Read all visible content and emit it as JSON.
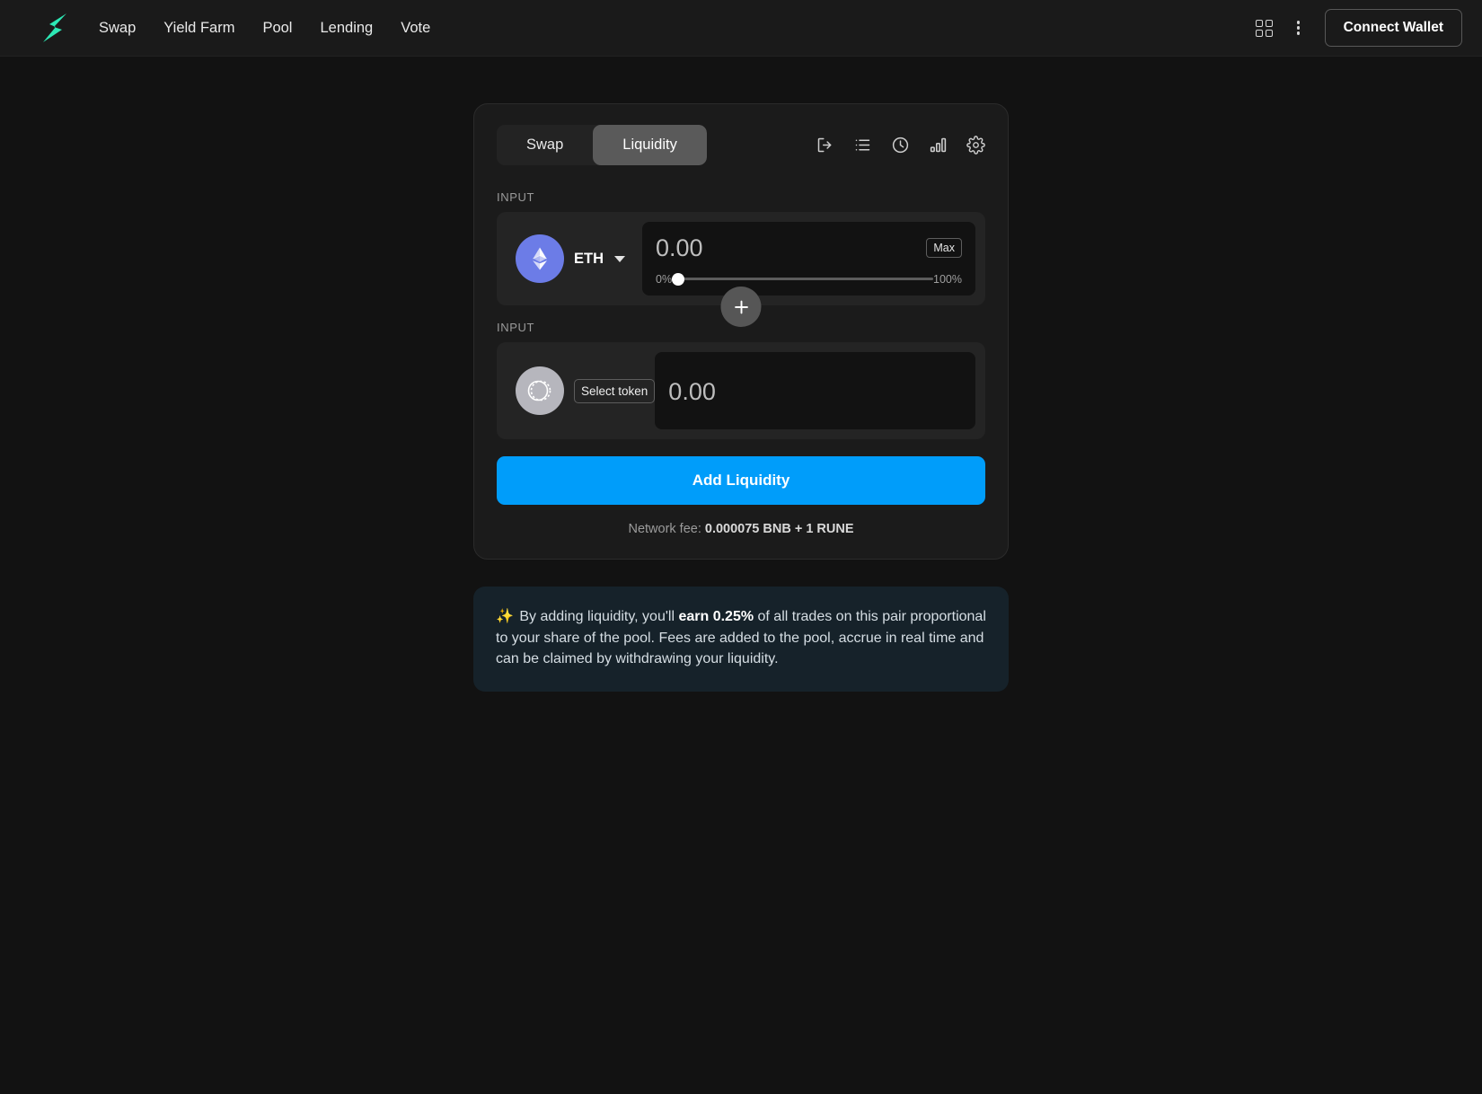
{
  "header": {
    "logo_icon": "lightning-bolt-logo",
    "logo_color": "#2de8b5",
    "nav": [
      {
        "label": "Swap"
      },
      {
        "label": "Yield Farm"
      },
      {
        "label": "Pool"
      },
      {
        "label": "Lending"
      },
      {
        "label": "Vote"
      }
    ],
    "grid_icon": "grid-apps-icon",
    "more_icon": "vertical-dots-icon",
    "connect_wallet_label": "Connect Wallet"
  },
  "card": {
    "tabs": [
      {
        "label": "Swap",
        "active": false
      },
      {
        "label": "Liquidity",
        "active": true
      }
    ],
    "tool_icons": [
      {
        "name": "export-icon"
      },
      {
        "name": "list-icon"
      },
      {
        "name": "clock-history-icon"
      },
      {
        "name": "bar-chart-icon"
      },
      {
        "name": "gear-settings-icon"
      }
    ],
    "input_one": {
      "label": "INPUT",
      "token_symbol": "ETH",
      "token_icon": "ethereum-icon",
      "token_color": "#6c7ce7",
      "amount_value": "0.00",
      "amount_placeholder": "0.00",
      "max_label": "Max",
      "slider_min_label": "0%",
      "slider_max_label": "100%",
      "slider_value": 0
    },
    "plus_icon": "plus-icon",
    "input_two": {
      "label": "INPUT",
      "token_icon": "unknown-token-icon",
      "token_color": "#b6b6bd",
      "select_token_label": "Select token",
      "amount_value": "0.00",
      "amount_placeholder": "0.00"
    },
    "submit_label": "Add Liquidity",
    "submit_color": "#009dfa",
    "network_fee_prefix": "Network fee: ",
    "network_fee_value": "0.000075 BNB + 1 RUNE"
  },
  "info_banner": {
    "sparkle_icon": "✨",
    "text_part_1": " By adding liquidity, you'll ",
    "bold_part": "earn 0.25%",
    "text_part_2": " of all trades on this pair proportional to your share of the pool. Fees are added to the pool, accrue in real time and can be claimed by withdrawing your liquidity."
  }
}
